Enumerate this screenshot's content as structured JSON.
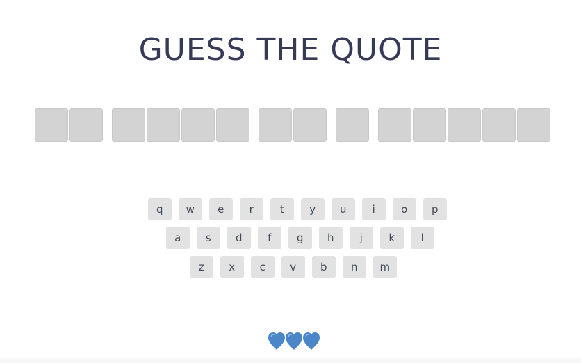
{
  "game": {
    "title": "GUESS THE QUOTE"
  },
  "board": {
    "words": [
      {
        "letters": [
          "",
          ""
        ]
      },
      {
        "letters": [
          "",
          "",
          "",
          ""
        ]
      },
      {
        "letters": [
          "",
          ""
        ]
      },
      {
        "letters": [
          ""
        ]
      },
      {
        "letters": [
          "",
          "",
          "",
          "",
          ""
        ]
      }
    ]
  },
  "keyboard": {
    "rows": [
      [
        "q",
        "w",
        "e",
        "r",
        "t",
        "y",
        "u",
        "i",
        "o",
        "p"
      ],
      [
        "a",
        "s",
        "d",
        "f",
        "g",
        "h",
        "j",
        "k",
        "l"
      ],
      [
        "z",
        "x",
        "c",
        "v",
        "b",
        "n",
        "m"
      ]
    ]
  },
  "lives": {
    "remaining": 3,
    "icon": "blue-heart-icon",
    "color": "#4a86c8"
  },
  "colors": {
    "title": "#363a57",
    "tile": "#d3d3d3",
    "key": "#e2e2e2",
    "key_text": "#444a55"
  }
}
